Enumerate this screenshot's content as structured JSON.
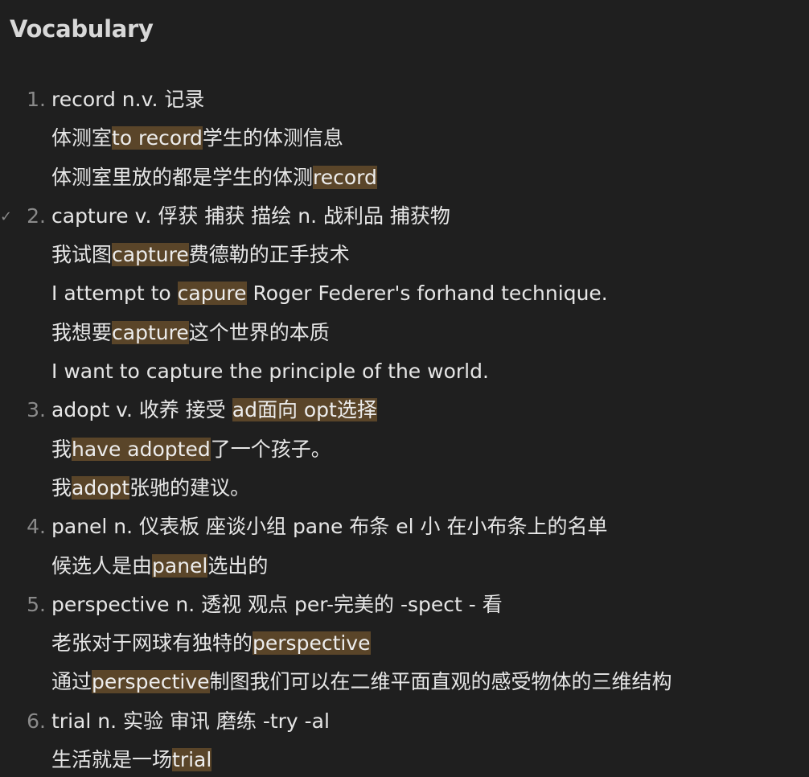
{
  "heading": "Vocabulary",
  "check_icon": "✓",
  "lines": [
    {
      "marker": "1.",
      "segments": [
        {
          "text": "record n.v. 记录",
          "hl": false
        }
      ]
    },
    {
      "segments": [
        {
          "text": "体测室",
          "hl": false
        },
        {
          "text": "to record",
          "hl": true
        },
        {
          "text": "学生的体测信息",
          "hl": false
        }
      ]
    },
    {
      "segments": [
        {
          "text": "体测室里放的都是学生的体测",
          "hl": false
        },
        {
          "text": "record",
          "hl": true
        }
      ]
    },
    {
      "marker": "2.",
      "checked": true,
      "segments": [
        {
          "text": "capture v. 俘获 捕获 描绘 n. 战利品 捕获物",
          "hl": false
        }
      ]
    },
    {
      "segments": [
        {
          "text": "我试图",
          "hl": false
        },
        {
          "text": "capture",
          "hl": true
        },
        {
          "text": "费德勒的正手技术",
          "hl": false
        }
      ]
    },
    {
      "segments": [
        {
          "text": "I attempt to ",
          "hl": false
        },
        {
          "text": "capure",
          "hl": true
        },
        {
          "text": " Roger Federer's forhand technique.",
          "hl": false
        }
      ]
    },
    {
      "segments": [
        {
          "text": "我想要",
          "hl": false
        },
        {
          "text": "capture",
          "hl": true
        },
        {
          "text": "这个世界的本质",
          "hl": false
        }
      ]
    },
    {
      "segments": [
        {
          "text": "I want to capture the principle of the world.",
          "hl": false
        }
      ]
    },
    {
      "marker": "3.",
      "segments": [
        {
          "text": "adopt v. 收养 接受 ",
          "hl": false
        },
        {
          "text": "ad面向 opt选择",
          "hl": true
        }
      ]
    },
    {
      "segments": [
        {
          "text": "我",
          "hl": false
        },
        {
          "text": "have adopted",
          "hl": true
        },
        {
          "text": "了一个孩子。",
          "hl": false
        }
      ]
    },
    {
      "segments": [
        {
          "text": "我",
          "hl": false
        },
        {
          "text": "adopt",
          "hl": true
        },
        {
          "text": "张驰的建议。",
          "hl": false
        }
      ]
    },
    {
      "marker": "4.",
      "segments": [
        {
          "text": "panel n. 仪表板 座谈小组 pane 布条 el 小 在小布条上的名单",
          "hl": false
        }
      ]
    },
    {
      "segments": [
        {
          "text": "候选人是由",
          "hl": false
        },
        {
          "text": "panel",
          "hl": true
        },
        {
          "text": "选出的",
          "hl": false
        }
      ]
    },
    {
      "marker": "5.",
      "segments": [
        {
          "text": "perspective n. 透视 观点 per-完美的 -spect - 看",
          "hl": false
        }
      ]
    },
    {
      "segments": [
        {
          "text": "老张对于网球有独特的",
          "hl": false
        },
        {
          "text": "perspective",
          "hl": true
        }
      ]
    },
    {
      "segments": [
        {
          "text": "通过",
          "hl": false
        },
        {
          "text": "perspective",
          "hl": true
        },
        {
          "text": "制图我们可以在二维平面直观的感受物体的三维结构",
          "hl": false
        }
      ]
    },
    {
      "marker": "6.",
      "segments": [
        {
          "text": "trial n. 实验 审讯 磨练 -try -al",
          "hl": false
        }
      ]
    },
    {
      "segments": [
        {
          "text": "生活就是一场",
          "hl": false
        },
        {
          "text": "trial",
          "hl": true
        }
      ]
    }
  ]
}
